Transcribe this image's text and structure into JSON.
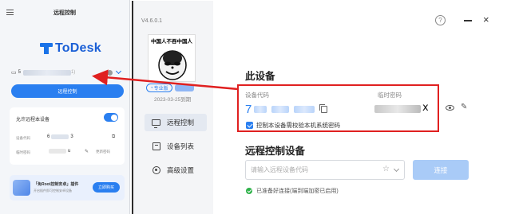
{
  "phone": {
    "title": "远程控制",
    "logo_text": "ToDesk",
    "device_prefix": "5",
    "device_suffix": "1)",
    "control_button": "远程控制",
    "allow_label": "允许远程本设备",
    "code_label": "设备代码",
    "code_start": "6",
    "code_end": "3",
    "pwd_label": "临时密码",
    "pwd_end": "u",
    "update_label": "更新密码",
    "promo_title": "「免Root控制安卓」插件",
    "promo_sub": "开启插件即可控制安卓设备",
    "buy_button": "立即购买"
  },
  "window": {
    "version": "V4.6.0.1",
    "avatar_caption": "中国人不吞中国人",
    "badge_text": "专业版",
    "expiry": "2023-03-25到期",
    "nav": [
      {
        "label": "远程控制",
        "icon": "monitor-icon",
        "active": true
      },
      {
        "label": "设备列表",
        "icon": "device-list-icon",
        "active": false
      },
      {
        "label": "高级设置",
        "icon": "gear-icon",
        "active": false
      }
    ],
    "help": "?",
    "minimize": "—",
    "close": "×",
    "this_device": {
      "title": "此设备",
      "code_label": "设备代码",
      "code_first_digit": "7",
      "pwd_label": "临时密码",
      "pwd_end": "x",
      "checkbox_label": "控制本设备需校验本机系统密码"
    },
    "remote": {
      "title": "远程控制设备",
      "input_placeholder": "请输入远程设备代码",
      "connect_button": "连接",
      "status": "已准备好连接(端到端加密已启用)"
    }
  },
  "colors": {
    "accent": "#2a7ff0",
    "highlight": "#e02020",
    "ok": "#2fb24a"
  }
}
